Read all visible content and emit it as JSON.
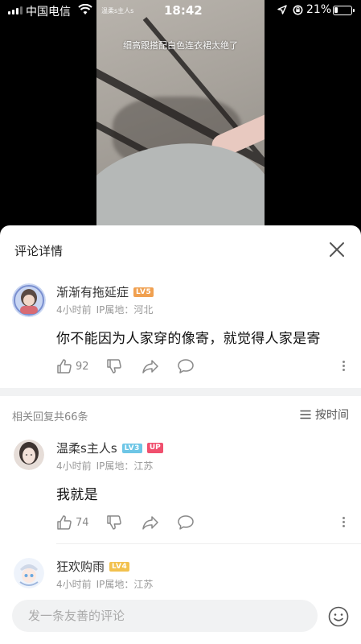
{
  "status_bar": {
    "carrier": "中国电信",
    "tiny_text": "温柔s主人s",
    "time": "18:42",
    "battery": "21%"
  },
  "video": {
    "caption": "细高跟搭配白色连衣裙太绝了"
  },
  "sheet": {
    "title": "评论详情"
  },
  "main_comment": {
    "username": "渐渐有拖延症",
    "level": "LV5",
    "time": "4小时前",
    "ip": "IP属地：河北",
    "text": "你不能因为人家穿的像寄，就觉得人家是寄",
    "likes": "92"
  },
  "replies_header": {
    "count_text": "相关回复共66条",
    "sort_label": "按时间"
  },
  "replies": [
    {
      "username": "温柔s主人s",
      "level": "LV3",
      "badge": "UP",
      "time": "4小时前",
      "ip": "IP属地：江苏",
      "text": "我就是",
      "likes": "74"
    },
    {
      "username": "狂欢购雨",
      "level": "LV4",
      "time": "4小时前",
      "ip": "IP属地：江苏"
    }
  ],
  "input": {
    "placeholder": "发一条友善的评论"
  },
  "colors": {
    "lv5": "#f0a050",
    "lv3": "#6ec6e6",
    "lv4": "#f2c14e",
    "up_badge": "#f0506e"
  }
}
